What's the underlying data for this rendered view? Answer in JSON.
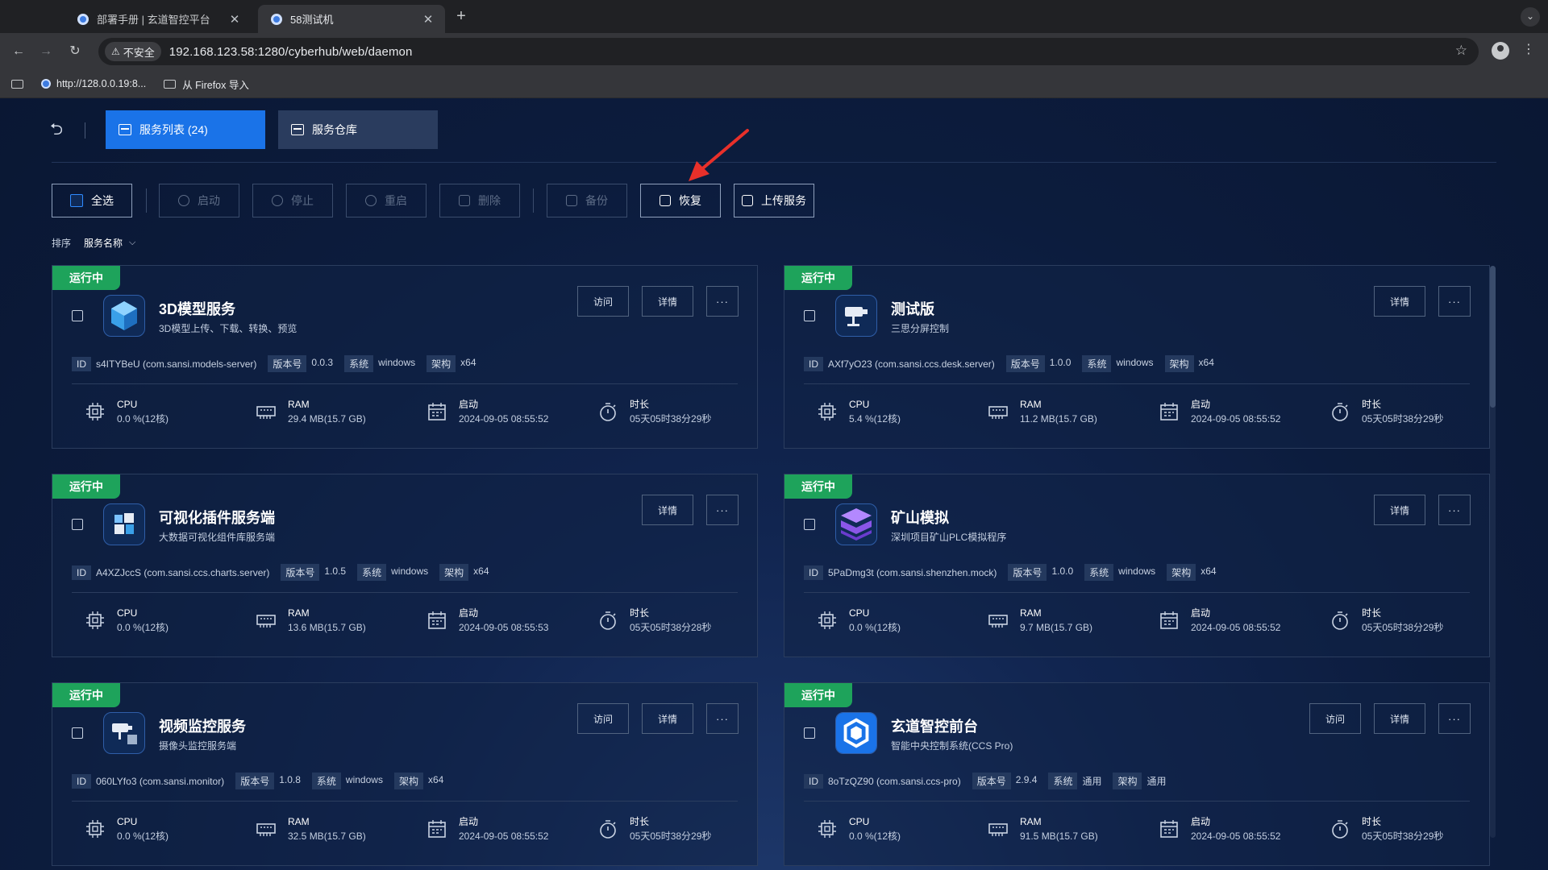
{
  "browser": {
    "tabs": [
      {
        "label": "部署手册 | 玄道智控平台",
        "active": false
      },
      {
        "label": "58测试机",
        "active": true
      }
    ],
    "security_label": "不安全",
    "url": "192.168.123.58:1280/cyberhub/web/daemon",
    "bookmarks": [
      {
        "label": "http://128.0.0.19:8..."
      },
      {
        "label": "从 Firefox 导入"
      }
    ]
  },
  "nav": {
    "service_list": "服务列表 (24)",
    "service_repo": "服务仓库"
  },
  "actions": {
    "select_all": "全选",
    "start": "启动",
    "stop": "停止",
    "restart": "重启",
    "delete": "删除",
    "backup": "备份",
    "restore": "恢复",
    "upload": "上传服务"
  },
  "sort": {
    "label": "排序",
    "value": "服务名称"
  },
  "labels": {
    "running": "运行中",
    "visit": "访问",
    "detail": "详情",
    "more": "···",
    "id": "ID",
    "version": "版本号",
    "system": "系统",
    "arch": "架构",
    "cpu": "CPU",
    "ram": "RAM",
    "start": "启动",
    "duration": "时长"
  },
  "services": [
    {
      "name": "3D模型服务",
      "desc": "3D模型上传、下载、转换、预览",
      "id": "s4ITYBeU (com.sansi.models-server)",
      "version": "0.0.3",
      "system": "windows",
      "arch": "x64",
      "cpu": "0.0 %(12核)",
      "ram": "29.4 MB(15.7 GB)",
      "started": "2024-09-05 08:55:52",
      "duration": "05天05时38分29秒",
      "logo": "cube-logo-icon"
    },
    {
      "name": "测试版",
      "desc": "三思分屏控制",
      "id": "AXf7yO23 (com.sansi.ccs.desk.server)",
      "version": "1.0.0",
      "system": "windows",
      "arch": "x64",
      "cpu": "5.4 %(12核)",
      "ram": "11.2 MB(15.7 GB)",
      "started": "2024-09-05 08:55:52",
      "duration": "05天05时38分29秒",
      "logo": "camera-logo-icon"
    },
    {
      "name": "可视化插件服务端",
      "desc": "大数据可视化组件库服务端",
      "id": "A4XZJccS (com.sansi.ccs.charts.server)",
      "version": "1.0.5",
      "system": "windows",
      "arch": "x64",
      "cpu": "0.0 %(12核)",
      "ram": "13.6 MB(15.7 GB)",
      "started": "2024-09-05 08:55:53",
      "duration": "05天05时38分28秒",
      "logo": "blocks-logo-icon"
    },
    {
      "name": "矿山模拟",
      "desc": "深圳项目矿山PLC模拟程序",
      "id": "5PaDmg3t (com.sansi.shenzhen.mock)",
      "version": "1.0.0",
      "system": "windows",
      "arch": "x64",
      "cpu": "0.0 %(12核)",
      "ram": "9.7 MB(15.7 GB)",
      "started": "2024-09-05 08:55:52",
      "duration": "05天05时38分29秒",
      "logo": "layers-logo-icon"
    },
    {
      "name": "视频监控服务",
      "desc": "摄像头监控服务端",
      "id": "060LYfo3 (com.sansi.monitor)",
      "version": "1.0.8",
      "system": "windows",
      "arch": "x64",
      "cpu": "0.0 %(12核)",
      "ram": "32.5 MB(15.7 GB)",
      "started": "2024-09-05 08:55:52",
      "duration": "05天05时38分29秒",
      "logo": "monitor-logo-icon"
    },
    {
      "name": "玄道智控前台",
      "desc": "智能中央控制系统(CCS Pro)",
      "id": "8oTzQZ90 (com.sansi.ccs-pro)",
      "version": "2.9.4",
      "system": "通用",
      "arch": "通用",
      "cpu": "0.0 %(12核)",
      "ram": "91.5 MB(15.7 GB)",
      "started": "2024-09-05 08:55:52",
      "duration": "05天05时38分29秒",
      "logo": "hexagon-logo-icon"
    }
  ]
}
